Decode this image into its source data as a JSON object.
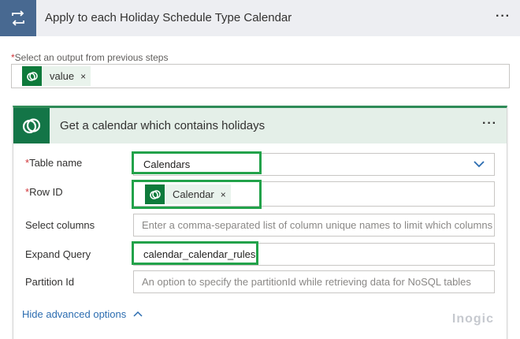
{
  "loop": {
    "title": "Apply to each Holiday Schedule Type Calendar",
    "icon": "loop-icon",
    "menu_label": "···"
  },
  "select_output": {
    "required_mark": "*",
    "label": "Select an output from previous steps",
    "token": {
      "label": "value",
      "remove": "×",
      "icon": "dataverse-icon"
    }
  },
  "action": {
    "title": "Get a calendar which contains holidays",
    "icon": "dataverse-icon",
    "menu_label": "···",
    "fields": {
      "table_name": {
        "required_mark": "*",
        "label": "Table name",
        "value": "Calendars",
        "icon": "chevron-down-icon"
      },
      "row_id": {
        "required_mark": "*",
        "label": "Row ID",
        "token": {
          "label": "Calendar",
          "remove": "×",
          "icon": "dataverse-icon"
        }
      },
      "select_columns": {
        "label": "Select columns",
        "placeholder": "Enter a comma-separated list of column unique names to limit which columns a"
      },
      "expand_query": {
        "label": "Expand Query",
        "value": "calendar_calendar_rules"
      },
      "partition_id": {
        "label": "Partition Id",
        "placeholder": "An option to specify the partitionId while retrieving data for NoSQL tables"
      }
    },
    "advanced_toggle": {
      "label": "Hide advanced options",
      "icon": "chevron-up-icon"
    }
  },
  "watermark": "Inogic",
  "colors": {
    "loop_header_bg": "#edeef2",
    "loop_icon_bg": "#486991",
    "action_accent": "#137547",
    "action_header_bg": "#e4efe8",
    "highlight": "#22a24a",
    "link": "#2b6cb0",
    "required": "#d13438"
  }
}
